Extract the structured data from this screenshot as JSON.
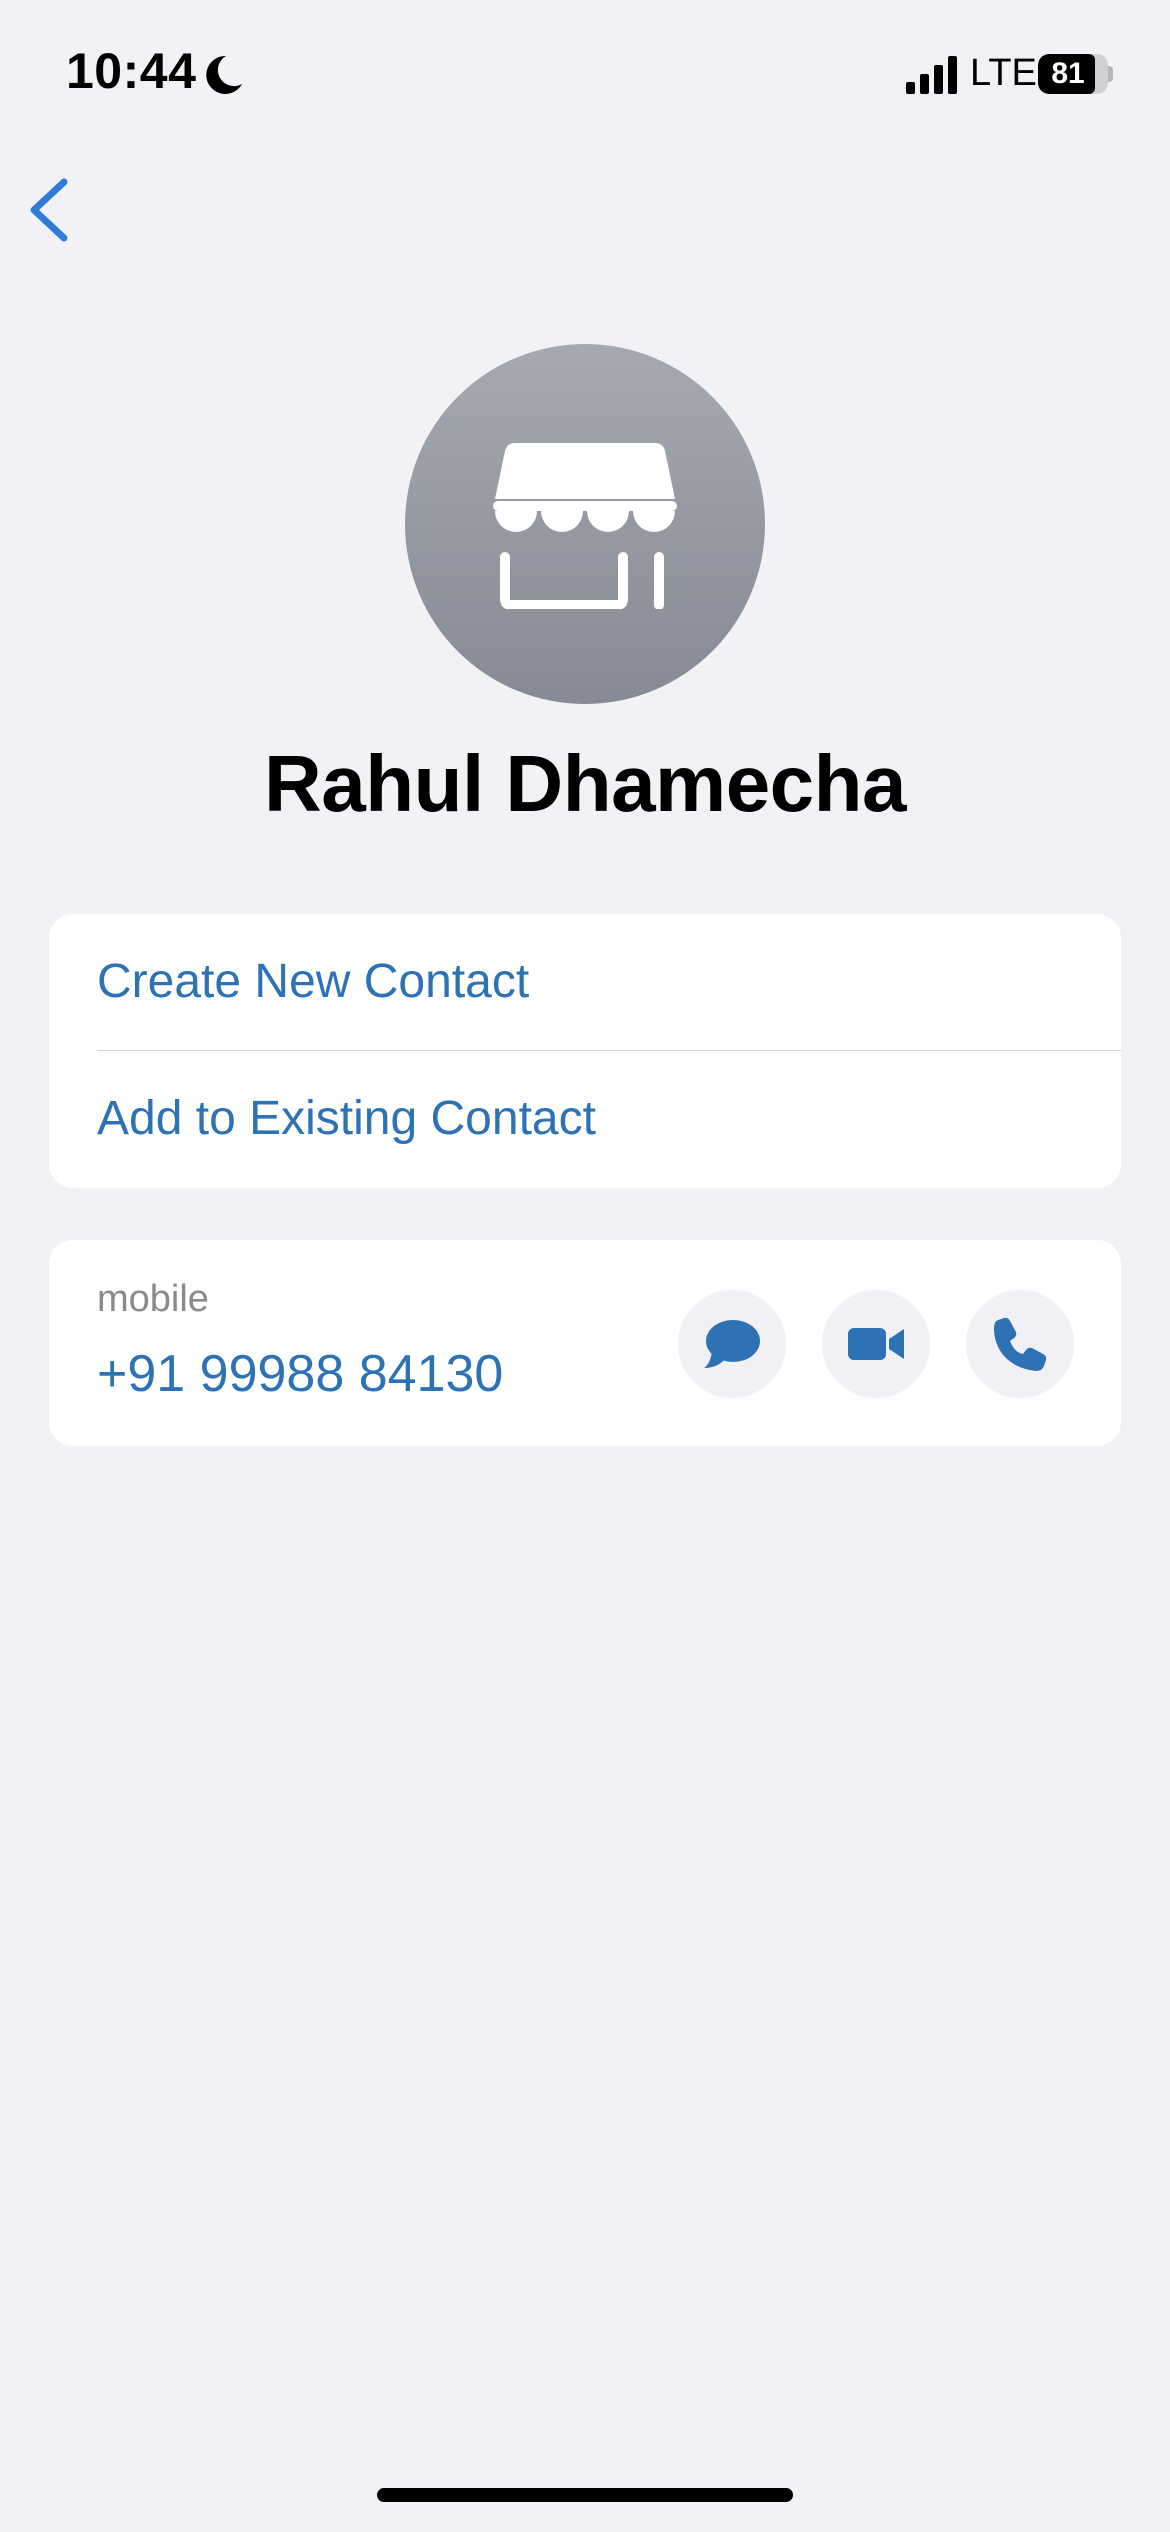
{
  "status_bar": {
    "time": "10:44",
    "network": "LTE",
    "battery_level": "81",
    "battery_fraction": 0.81
  },
  "nav": {
    "back_icon": "chevron-left-icon"
  },
  "contact": {
    "avatar_icon": "storefront-icon",
    "name": "Rahul Dhamecha"
  },
  "actions": {
    "create_new": "Create New Contact",
    "add_existing": "Add to Existing Contact"
  },
  "phone": {
    "label": "mobile",
    "number": "+91 99988 84130",
    "buttons": [
      "message-icon",
      "video-icon",
      "phone-icon"
    ]
  },
  "colors": {
    "accent": "#2c72b5",
    "background": "#f1f1f6",
    "card": "#ffffff",
    "secondary_text": "#8a8a8e"
  }
}
